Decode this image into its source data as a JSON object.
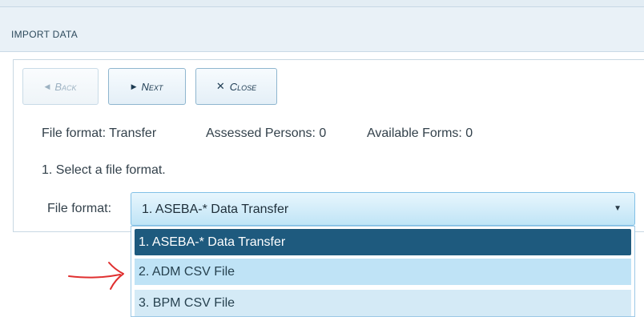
{
  "header": {
    "title": "IMPORT DATA"
  },
  "toolbar": {
    "back_label": "Back",
    "next_label": "Next",
    "close_label": "Close"
  },
  "status": {
    "file_format": "File format: Transfer",
    "assessed_persons": "Assessed Persons: 0",
    "available_forms": "Available Forms: 0"
  },
  "instruction": "1. Select a file format.",
  "file_format_field": {
    "label": "File format:",
    "selected": "1. ASEBA-* Data Transfer",
    "options": [
      "1. ASEBA-* Data Transfer",
      "2. ADM CSV File",
      "3. BPM CSV File"
    ]
  },
  "icons": {
    "back": "triangle-left-icon",
    "next": "triangle-right-icon",
    "close": "x-icon",
    "caret": "caret-down-icon",
    "annotation": "red-arrow-annotation"
  },
  "colors": {
    "header_bg": "#e9f1f7",
    "selected_option": "#1e5a7e",
    "hover_option": "#bfe3f6",
    "annotation": "#e03030"
  }
}
